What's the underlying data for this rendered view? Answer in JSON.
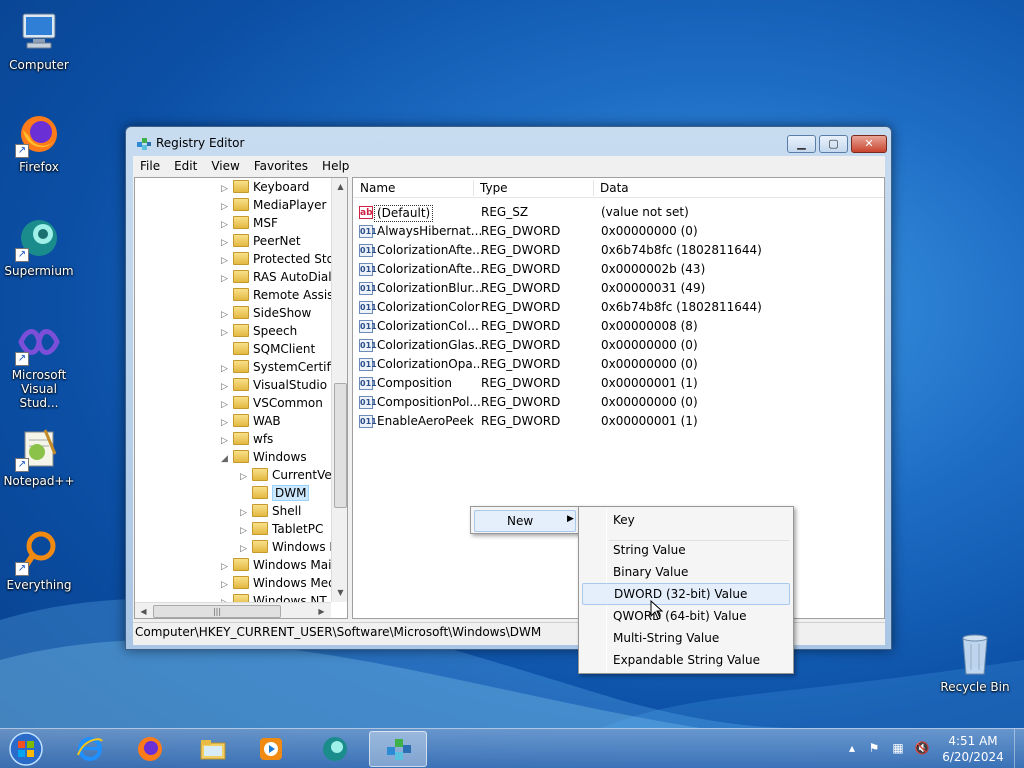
{
  "desktop": {
    "icons": [
      {
        "label": "Computer"
      },
      {
        "label": "Firefox"
      },
      {
        "label": "Supermium"
      },
      {
        "label": "Microsoft Visual Stud..."
      },
      {
        "label": "Notepad++"
      },
      {
        "label": "Everything"
      }
    ],
    "recycle_bin": "Recycle Bin"
  },
  "window": {
    "title": "Registry Editor",
    "menu": [
      "File",
      "Edit",
      "View",
      "Favorites",
      "Help"
    ],
    "tree": [
      {
        "label": "Keyboard",
        "arrow": "▷"
      },
      {
        "label": "MediaPlayer",
        "arrow": "▷"
      },
      {
        "label": "MSF",
        "arrow": "▷"
      },
      {
        "label": "PeerNet",
        "arrow": "▷"
      },
      {
        "label": "Protected Stor",
        "arrow": "▷"
      },
      {
        "label": "RAS AutoDial",
        "arrow": "▷"
      },
      {
        "label": "Remote Assist",
        "arrow": ""
      },
      {
        "label": "SideShow",
        "arrow": "▷"
      },
      {
        "label": "Speech",
        "arrow": "▷"
      },
      {
        "label": "SQMClient",
        "arrow": ""
      },
      {
        "label": "SystemCertific",
        "arrow": "▷"
      },
      {
        "label": "VisualStudio",
        "arrow": "▷"
      },
      {
        "label": "VSCommon",
        "arrow": "▷"
      },
      {
        "label": "WAB",
        "arrow": "▷"
      },
      {
        "label": "wfs",
        "arrow": "▷"
      },
      {
        "label": "Windows",
        "arrow": "◢"
      },
      {
        "label": "CurrentVer",
        "arrow": "▷"
      },
      {
        "label": "DWM",
        "arrow": ""
      },
      {
        "label": "Shell",
        "arrow": "▷"
      },
      {
        "label": "TabletPC",
        "arrow": "▷"
      },
      {
        "label": "Windows E",
        "arrow": "▷"
      },
      {
        "label": "Windows Mail",
        "arrow": "▷"
      },
      {
        "label": "Windows Med",
        "arrow": "▷"
      },
      {
        "label": "Windows NT",
        "arrow": "▷"
      }
    ],
    "list_headers": {
      "name": "Name",
      "type": "Type",
      "data": "Data"
    },
    "values": [
      {
        "icon": "ab",
        "name": "(Default)",
        "type": "REG_SZ",
        "data": "(value not set)"
      },
      {
        "icon": "011",
        "name": "AlwaysHibernat...",
        "type": "REG_DWORD",
        "data": "0x00000000 (0)"
      },
      {
        "icon": "011",
        "name": "ColorizationAfte...",
        "type": "REG_DWORD",
        "data": "0x6b74b8fc (1802811644)"
      },
      {
        "icon": "011",
        "name": "ColorizationAfte...",
        "type": "REG_DWORD",
        "data": "0x0000002b (43)"
      },
      {
        "icon": "011",
        "name": "ColorizationBlur...",
        "type": "REG_DWORD",
        "data": "0x00000031 (49)"
      },
      {
        "icon": "011",
        "name": "ColorizationColor",
        "type": "REG_DWORD",
        "data": "0x6b74b8fc (1802811644)"
      },
      {
        "icon": "011",
        "name": "ColorizationCol...",
        "type": "REG_DWORD",
        "data": "0x00000008 (8)"
      },
      {
        "icon": "011",
        "name": "ColorizationGlas...",
        "type": "REG_DWORD",
        "data": "0x00000000 (0)"
      },
      {
        "icon": "011",
        "name": "ColorizationOpa...",
        "type": "REG_DWORD",
        "data": "0x00000000 (0)"
      },
      {
        "icon": "011",
        "name": "Composition",
        "type": "REG_DWORD",
        "data": "0x00000001 (1)"
      },
      {
        "icon": "011",
        "name": "CompositionPol...",
        "type": "REG_DWORD",
        "data": "0x00000000 (0)"
      },
      {
        "icon": "011",
        "name": "EnableAeroPeek",
        "type": "REG_DWORD",
        "data": "0x00000001 (1)"
      }
    ],
    "status": "Computer\\HKEY_CURRENT_USER\\Software\\Microsoft\\Windows\\DWM"
  },
  "context_menu": {
    "new_label": "New",
    "submenu": [
      "Key",
      "String Value",
      "Binary Value",
      "DWORD (32-bit) Value",
      "QWORD (64-bit) Value",
      "Multi-String Value",
      "Expandable String Value"
    ],
    "highlighted": "DWORD (32-bit) Value"
  },
  "taskbar": {
    "apps": [
      "internet-explorer",
      "firefox",
      "file-explorer",
      "media-player",
      "supermium",
      "registry-editor"
    ],
    "active_app": "registry-editor",
    "time": "4:51 AM",
    "date": "6/20/2024"
  },
  "colors": {
    "selection": "#cce8ff",
    "menu_hover": "#e5eefb"
  }
}
